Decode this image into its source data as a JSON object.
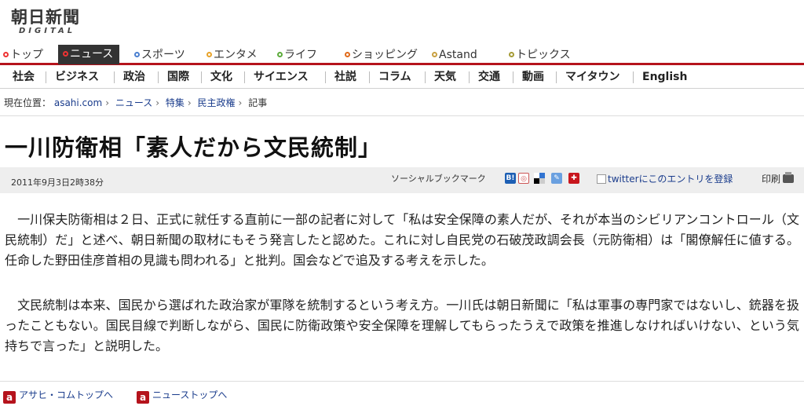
{
  "logo": {
    "main": "朝日新聞",
    "sub": "DIGITAL"
  },
  "topnav": [
    {
      "label": "トップ",
      "color": "#e33"
    },
    {
      "label": "ニュース",
      "color": "#e33",
      "active": true
    },
    {
      "label": "スポーツ",
      "color": "#4a7fd0"
    },
    {
      "label": "エンタメ",
      "color": "#e8a32a"
    },
    {
      "label": "ライフ",
      "color": "#5cab3b"
    },
    {
      "label": "ショッピング",
      "color": "#e06a1a"
    },
    {
      "label": "Astand",
      "color": "#c8a040"
    },
    {
      "label": "トピックス",
      "color": "#a59b36"
    }
  ],
  "subnav": [
    "社会",
    "ビジネス",
    "政治",
    "国際",
    "文化",
    "サイエンス",
    "社説",
    "コラム",
    "天気",
    "交通",
    "動画",
    "マイタウン",
    "English"
  ],
  "breadcrumb": {
    "prefix": "現在位置：",
    "links": [
      "asahi.com",
      "ニュース",
      "特集",
      "民主政権"
    ],
    "current": "記事"
  },
  "article": {
    "headline": "一川防衛相「素人だから文民統制」",
    "date": "2011年9月3日2時38分",
    "social_label": "ソーシャルブックマーク",
    "twitter_label": "twitterにこのエントリを登録",
    "print_label": "印刷",
    "paragraphs": [
      "　一川保夫防衛相は２日、正式に就任する直前に一部の記者に対して「私は安全保障の素人だが、それが本当のシビリアンコントロール（文民統制）だ」と述べ、朝日新聞の取材にもそう発言したと認めた。これに対し自民党の石破茂政調会長（元防衛相）は「閣僚解任に値する。任命した野田佳彦首相の見識も問われる」と批判。国会などで追及する考えを示した。",
      "　文民統制は本来、国民から選ばれた政治家が軍隊を統制するという考え方。一川氏は朝日新聞に「私は軍事の専門家ではないし、銃器を扱ったこともない。国民目線で判断しながら、国民に防衛政策や安全保障を理解してもらったうえで政策を推進しなければいけない、という気持ちで言った」と説明した。"
    ]
  },
  "footer": {
    "link1": "アサヒ・コムトップへ",
    "link2": "ニューストップへ",
    "icon_letter": "a"
  },
  "colors": {
    "accent": "#b5131c",
    "link": "#1a3c8c"
  }
}
